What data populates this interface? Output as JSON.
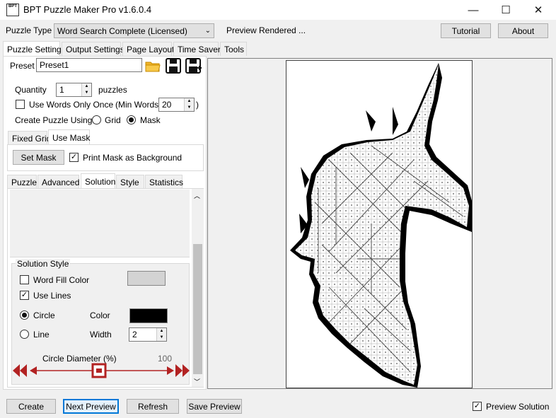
{
  "window": {
    "title": "BPT Puzzle Maker Pro v1.6.0.4",
    "icon_text": "BPT",
    "minimize_glyph": "—",
    "maximize_glyph": "☐",
    "close_glyph": "✕"
  },
  "top": {
    "puzzle_type_label": "Puzzle Type",
    "puzzle_type_value": "Word Search Complete (Licensed)",
    "status": "Preview Rendered ...",
    "tutorial_button": "Tutorial",
    "about_button": "About"
  },
  "main_tabs": [
    "Puzzle Settings",
    "Output Settings",
    "Page Layout",
    "Time Saver",
    "Tools"
  ],
  "preset": {
    "label": "Preset",
    "value": "Preset1"
  },
  "quantity": {
    "label": "Quantity",
    "value": "1",
    "unit": "puzzles"
  },
  "use_words_once": {
    "label": "Use Words Only Once",
    "checked": false
  },
  "min_words": {
    "label": "(Min Words:",
    "value": "20",
    "close": ")"
  },
  "create_using": {
    "label": "Create Puzzle Using:",
    "grid": "Grid",
    "mask": "Mask",
    "selected": "Mask"
  },
  "grid_tabs": [
    "Fixed Grid",
    "Use Mask"
  ],
  "mask": {
    "set_button": "Set Mask",
    "print_bg_label": "Print Mask as Background",
    "print_bg_checked": true
  },
  "sub_tabs": [
    "Puzzle",
    "Advanced",
    "Solution",
    "Style",
    "Statistics"
  ],
  "solution_style": {
    "title": "Solution Style",
    "word_fill_label": "Word Fill Color",
    "word_fill_checked": false,
    "word_fill_color": "#d3d3d3",
    "use_lines_label": "Use Lines",
    "use_lines_checked": true,
    "circle_label": "Circle",
    "line_label": "Line",
    "shape_selected": "Circle",
    "color_label": "Color",
    "line_color": "#000000",
    "width_label": "Width",
    "width_value": "2",
    "diameter_label": "Circle Diameter (%)",
    "diameter_value": "100"
  },
  "bottom": {
    "create": "Create",
    "next_preview": "Next Preview",
    "refresh": "Refresh",
    "save_preview": "Save Preview",
    "preview_solution_label": "Preview Solution",
    "preview_solution_checked": true
  },
  "accent_color": "#b22222"
}
